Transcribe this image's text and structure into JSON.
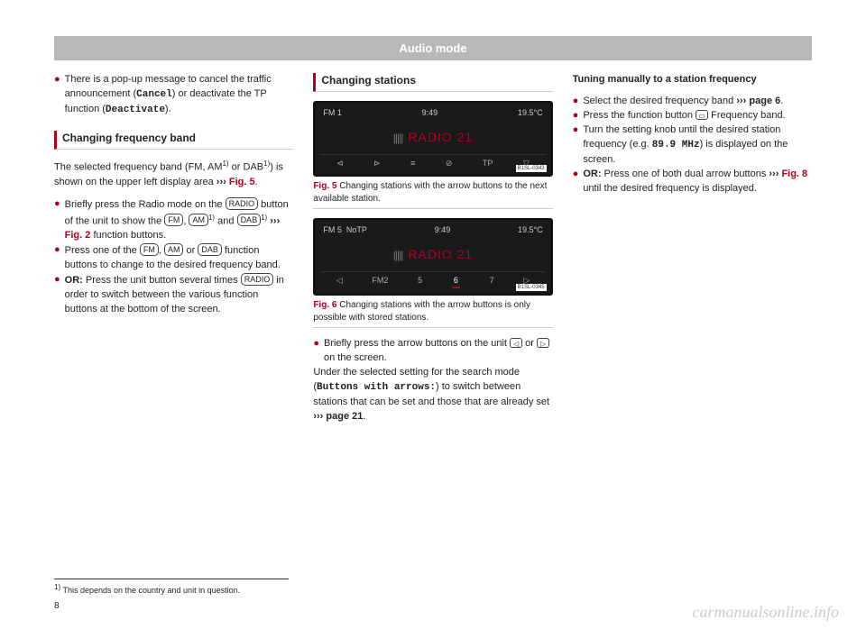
{
  "header": {
    "title": "Audio mode"
  },
  "col1": {
    "intro_bullet": "There is a pop-up message to cancel the traffic announcement (",
    "cancel": "Cancel",
    "intro_mid": ") or deactivate the TP function (",
    "deactivate": "Deactivate",
    "intro_end": ").",
    "subhead": "Changing frequency band",
    "para1_a": "The selected frequency band (FM, AM",
    "sup1": "1)",
    "para1_b": " or DAB",
    "para1_c": ") is shown on the upper left display area ",
    "chev": "›››",
    "fig5": "Fig. 5",
    "period": ".",
    "b2_a": "Briefly press the Radio mode on the ",
    "pill_radio": "RADIO",
    "b2_b": " button of the unit to show the ",
    "pill_fm": "FM",
    "comma": ", ",
    "pill_am": "AM",
    "b2_c": " and ",
    "pill_dab": "DAB",
    "b2_d": " ",
    "fig2": "Fig. 2",
    "b2_e": " function buttons.",
    "b3_a": "Press one of the ",
    "b3_b": " or ",
    "b3_c": " function buttons to change to the desired frequency band.",
    "b4_a": "OR:",
    "b4_b": " Press the unit button several times ",
    "b4_c": " in order to switch between the various function buttons at the bottom of the screen."
  },
  "col2": {
    "subhead": "Changing stations",
    "fig5": {
      "label": "Fig. 5",
      "text": "  Changing stations with the arrow buttons to the next available station."
    },
    "fig6": {
      "label": "Fig. 6",
      "text": "  Changing stations with the arrow buttons is only possible with stored stations."
    },
    "radio1": {
      "corner_l": "FM 1",
      "time": "9:49",
      "corner_r": "19.5°C",
      "title": "RADIO 21",
      "tag": "B1SL-0343",
      "bot": [
        "⊲",
        "⊳",
        "≡",
        "⊘",
        "TP",
        "▽"
      ]
    },
    "radio2": {
      "corner_l": "FM 5",
      "notp": "NoTP",
      "time": "9:49",
      "corner_r": "19.5°C",
      "title": "RADIO 21",
      "tag": "B1SL-0345",
      "bot_pre": "FM2",
      "bot": [
        "5",
        "6",
        "7"
      ],
      "tri_l": "◁",
      "tri_r": "▷"
    },
    "b1_a": "Briefly press the arrow buttons on the unit ",
    "sq_l": "◁",
    "b1_b": " or ",
    "sq_r": "▷",
    "b1_c": " on the screen.",
    "p2_a": "Under the selected setting for the search mode (",
    "mono": "Buttons with arrows:",
    "p2_b": ") to switch between stations that can be set and those that are already set ",
    "chev": "›››",
    "page21": "page 21",
    "period": "."
  },
  "col3": {
    "heading": "Tuning manually to a station frequency",
    "b1_a": "Select the desired frequency band ",
    "chev": "›››",
    "page6": "page 6",
    "period": ".",
    "b2_a": "Press the function button ",
    "sq": "▭",
    "b2_b": " Frequency band.",
    "b3_a": "Turn the setting knob until the desired station frequency (e.g. ",
    "mono": "89.9 MHz",
    "b3_b": ") is displayed on the screen.",
    "b4_a": "OR:",
    "b4_b": " Press one of both dual arrow buttons ",
    "fig8": "Fig. 8",
    "b4_c": " until the desired frequency is displayed."
  },
  "footnote": {
    "sup": "1)",
    "text": " This depends on the country and unit in question."
  },
  "pagenum": "8",
  "watermark": "carmanualsonline.info"
}
